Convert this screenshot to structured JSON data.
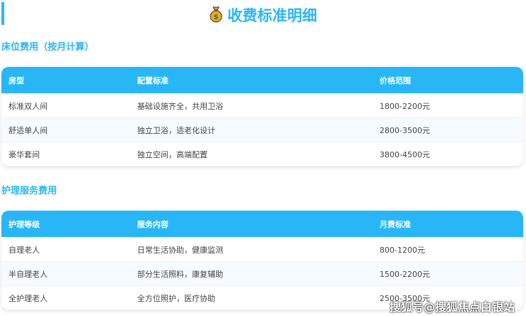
{
  "title": "收费标准明细",
  "bed": {
    "heading": "床位费用（按月计算）",
    "headers": [
      "房型",
      "配置标准",
      "价格范围"
    ],
    "rows": [
      [
        "标准双人间",
        "基础设施齐全，共用卫浴",
        "1800-2200元"
      ],
      [
        "舒适单人间",
        "独立卫浴，适老化设计",
        "2800-3500元"
      ],
      [
        "豪华套间",
        "独立空间，高端配置",
        "3800-4500元"
      ]
    ]
  },
  "care": {
    "heading": "护理服务费用",
    "headers": [
      "护理等级",
      "服务内容",
      "月费标准"
    ],
    "rows": [
      [
        "自理老人",
        "日常生活协助，健康监测",
        "800-1200元"
      ],
      [
        "半自理老人",
        "部分生活照料，康复辅助",
        "1500-2200元"
      ],
      [
        "全护理老人",
        "全方位照护，医疗协助",
        "2500-3500元"
      ]
    ]
  },
  "watermark": "搜狐号@搜狐焦点白银站",
  "colors": {
    "accent": "#29b6f6"
  }
}
